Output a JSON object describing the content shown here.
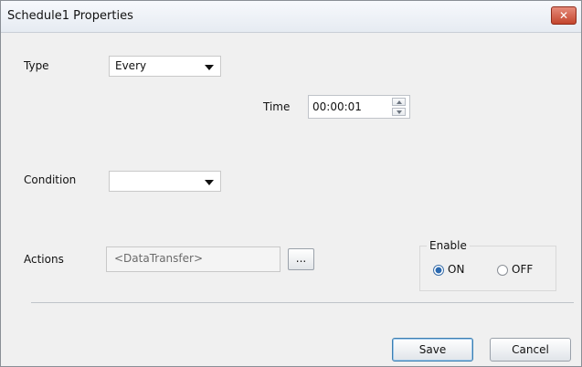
{
  "window": {
    "title": "Schedule1 Properties",
    "close_glyph": "✕"
  },
  "form": {
    "type_label": "Type",
    "type_value": "Every",
    "time_label": "Time",
    "time_value": "00:00:01",
    "condition_label": "Condition",
    "condition_value": "",
    "actions_label": "Actions",
    "actions_value": "<DataTransfer>",
    "browse_label": "..."
  },
  "enable": {
    "group_label": "Enable",
    "on_label": "ON",
    "off_label": "OFF",
    "selected": "ON"
  },
  "buttons": {
    "save": "Save",
    "cancel": "Cancel"
  },
  "icons": {
    "close": "close-icon",
    "dropdown": "chevron-down-icon",
    "spin_up": "arrow-up-icon",
    "spin_down": "arrow-down-icon"
  }
}
